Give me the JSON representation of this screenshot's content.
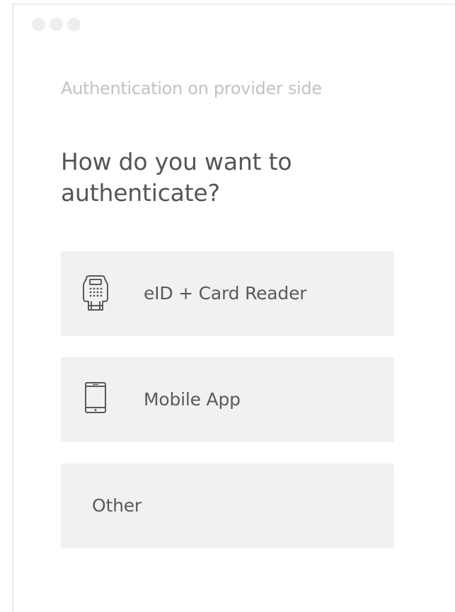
{
  "window": {
    "controls": [
      "dot-1",
      "dot-2",
      "dot-3"
    ]
  },
  "page": {
    "subtitle": "Authentication on provider side",
    "heading": "How do you want to authenticate?"
  },
  "options": [
    {
      "label": "eID + Card Reader",
      "icon": "card-reader-icon"
    },
    {
      "label": "Mobile App",
      "icon": "mobile-phone-icon"
    },
    {
      "label": "Other",
      "icon": ""
    }
  ],
  "colors": {
    "option_background": "#f1f1f1",
    "heading_text": "#555555",
    "subtitle_text": "#c2c2c2"
  }
}
